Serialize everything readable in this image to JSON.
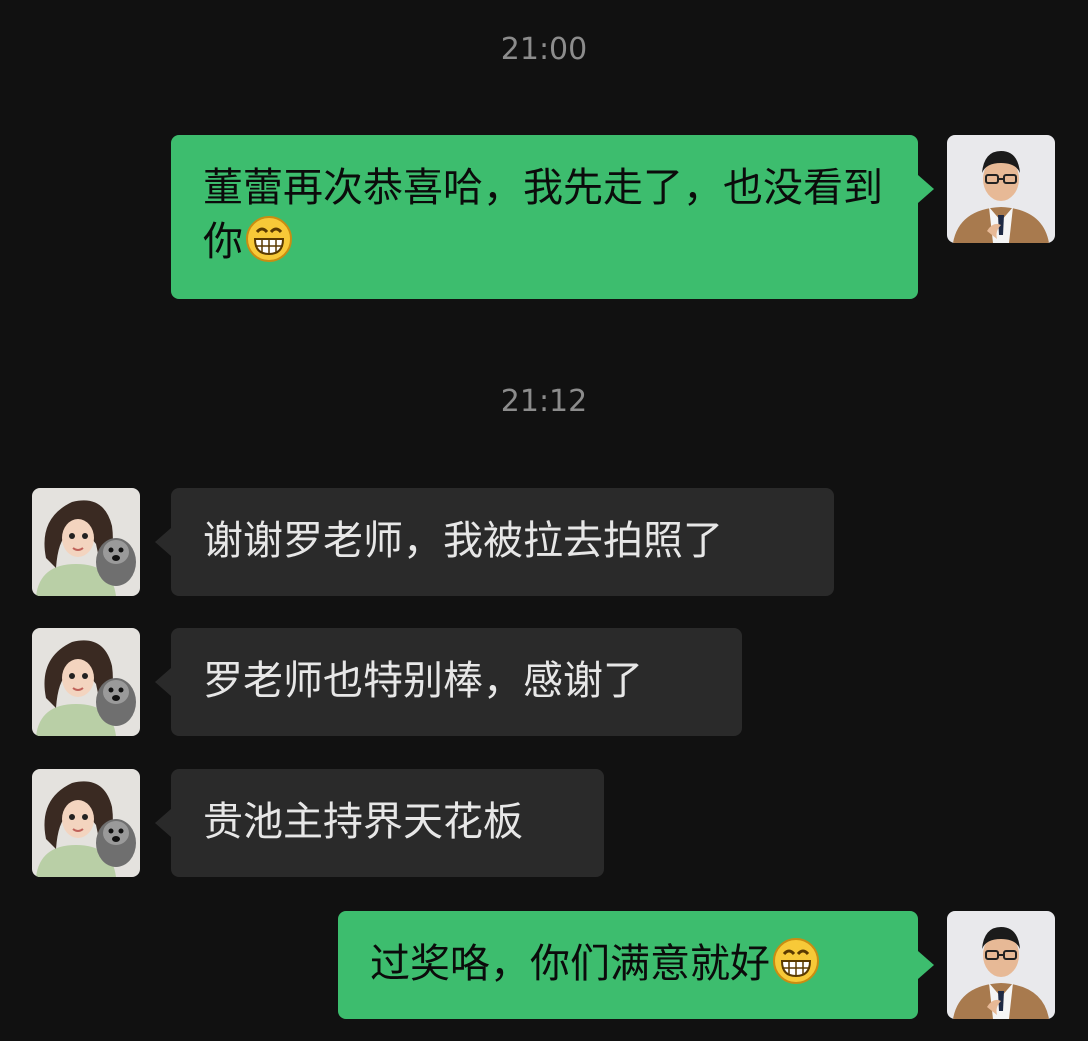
{
  "messages": [
    {
      "time": "21:00"
    },
    {
      "sender": "me",
      "text": "董蕾再次恭喜哈，我先走了，也没看到你",
      "emoji": "grinning-face-icon"
    },
    {
      "time": "21:12"
    },
    {
      "sender": "them",
      "text": "谢谢罗老师，我被拉去拍照了"
    },
    {
      "sender": "them",
      "text": "罗老师也特别棒，感谢了"
    },
    {
      "sender": "them",
      "text": "贵池主持界天花板"
    },
    {
      "sender": "me",
      "text": "过奖咯，你们满意就好",
      "emoji": "grinning-face-icon"
    }
  ],
  "colors": {
    "background": "#111111",
    "my_bubble": "#3dbd6e",
    "their_bubble": "#2a2a2a",
    "timestamp": "#8c8c8c"
  }
}
